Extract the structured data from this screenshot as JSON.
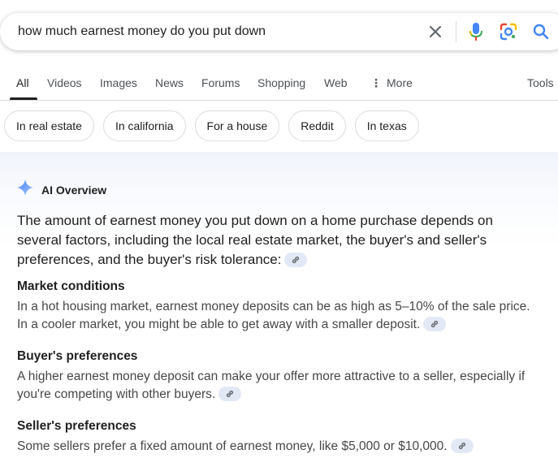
{
  "search": {
    "query": "how much earnest money do you put down"
  },
  "tabs": [
    {
      "label": "All",
      "active": true
    },
    {
      "label": "Videos"
    },
    {
      "label": "Images"
    },
    {
      "label": "News"
    },
    {
      "label": "Forums"
    },
    {
      "label": "Shopping"
    },
    {
      "label": "Web"
    },
    {
      "label": "More",
      "icon": "more-vert-icon"
    },
    {
      "label": "Tools"
    }
  ],
  "chips": [
    "In real estate",
    "In california",
    "For a house",
    "Reddit",
    "In texas"
  ],
  "ai_overview": {
    "label": "AI Overview",
    "lead": "The amount of earnest money you put down on a home purchase depends on several factors, including the local real estate market, the buyer's and seller's preferences, and the buyer's risk tolerance:",
    "sections": [
      {
        "title": "Market conditions",
        "body": "In a hot housing market, earnest money deposits can be as high as 5–10% of the sale price. In a cooler market, you might be able to get away with a smaller deposit."
      },
      {
        "title": "Buyer's preferences",
        "body": "A higher earnest money deposit can make your offer more attractive to a seller, especially if you're competing with other buyers."
      },
      {
        "title": "Seller's preferences",
        "body": "Some sellers prefer a fixed amount of earnest money, like $5,000 or $10,000."
      }
    ]
  },
  "colors": {
    "accent_blue": "#4285f4",
    "accent_red": "#ea4335",
    "accent_yellow": "#fbbc04",
    "accent_green": "#34a853",
    "cite_chip": "#e3e8f5"
  }
}
